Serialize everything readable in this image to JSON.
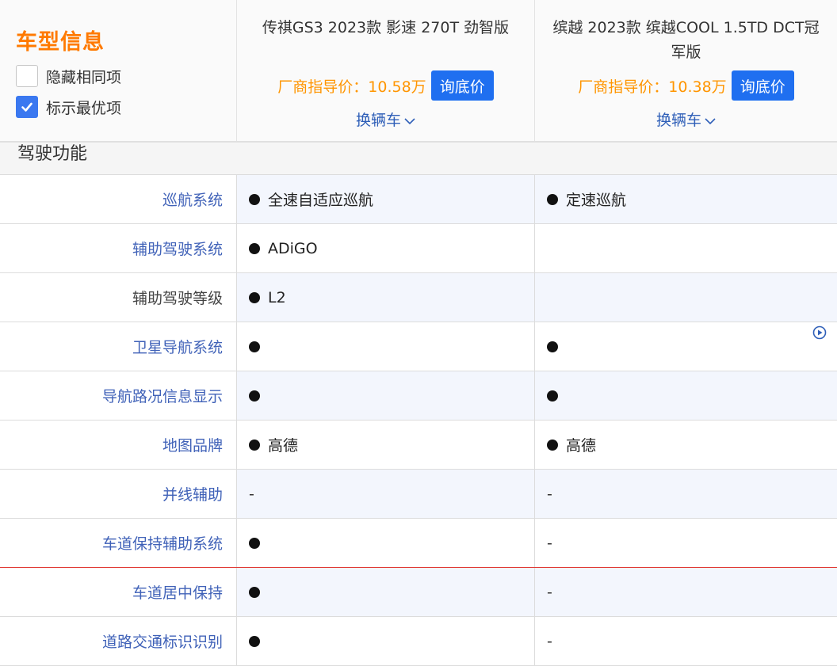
{
  "header": {
    "title": "车型信息",
    "options": [
      {
        "label": "隐藏相同项",
        "checked": false
      },
      {
        "label": "标示最优项",
        "checked": true
      }
    ]
  },
  "cars": [
    {
      "name": "传祺GS3 2023款 影速 270T 劲智版",
      "price": "厂商指导价：10.58万",
      "ask_label": "询底价",
      "switch_label": "换辆车"
    },
    {
      "name": "缤越 2023款 缤越COOL 1.5TD DCT冠军版",
      "price": "厂商指导价：10.38万",
      "ask_label": "询底价",
      "switch_label": "换辆车"
    }
  ],
  "section": {
    "title": "驾驶功能"
  },
  "rows": [
    {
      "label": "巡航系统",
      "link": true,
      "v1": {
        "dot": true,
        "text": "全速自适应巡航"
      },
      "v2": {
        "dot": true,
        "text": "定速巡航"
      }
    },
    {
      "label": "辅助驾驶系统",
      "link": true,
      "v1": {
        "dot": true,
        "text": "ADiGO"
      },
      "v2": {
        "dot": false,
        "text": ""
      }
    },
    {
      "label": "辅助驾驶等级",
      "link": false,
      "v1": {
        "dot": true,
        "text": "L2"
      },
      "v2": {
        "dot": false,
        "text": ""
      }
    },
    {
      "label": "卫星导航系统",
      "link": true,
      "v1": {
        "dot": true,
        "text": ""
      },
      "v2": {
        "dot": true,
        "text": ""
      }
    },
    {
      "label": "导航路况信息显示",
      "link": true,
      "v1": {
        "dot": true,
        "text": ""
      },
      "v2": {
        "dot": true,
        "text": ""
      }
    },
    {
      "label": "地图品牌",
      "link": true,
      "v1": {
        "dot": true,
        "text": "高德"
      },
      "v2": {
        "dot": true,
        "text": "高德"
      }
    },
    {
      "label": "并线辅助",
      "link": true,
      "v1": {
        "dot": false,
        "text": "-"
      },
      "v2": {
        "dot": false,
        "text": "-"
      }
    },
    {
      "label": "车道保持辅助系统",
      "link": true,
      "v1": {
        "dot": true,
        "text": ""
      },
      "v2": {
        "dot": false,
        "text": "-"
      }
    },
    {
      "label": "车道居中保持",
      "link": true,
      "v1": {
        "dot": true,
        "text": ""
      },
      "v2": {
        "dot": false,
        "text": "-"
      }
    },
    {
      "label": "道路交通标识识别",
      "link": true,
      "v1": {
        "dot": true,
        "text": ""
      },
      "v2": {
        "dot": false,
        "text": "-"
      }
    }
  ],
  "colors": {
    "accent_orange": "#ff7a00",
    "price_orange": "#ff9500",
    "button_blue": "#1f6ff0",
    "link_blue": "#4062b8",
    "row_highlight": "#f3f6fd",
    "divider_red": "#e0342f"
  },
  "icons": {
    "checkbox_checked": "checkmark-icon",
    "switch_chevron": "chevron-down-icon",
    "side_play": "play-circle-icon"
  }
}
